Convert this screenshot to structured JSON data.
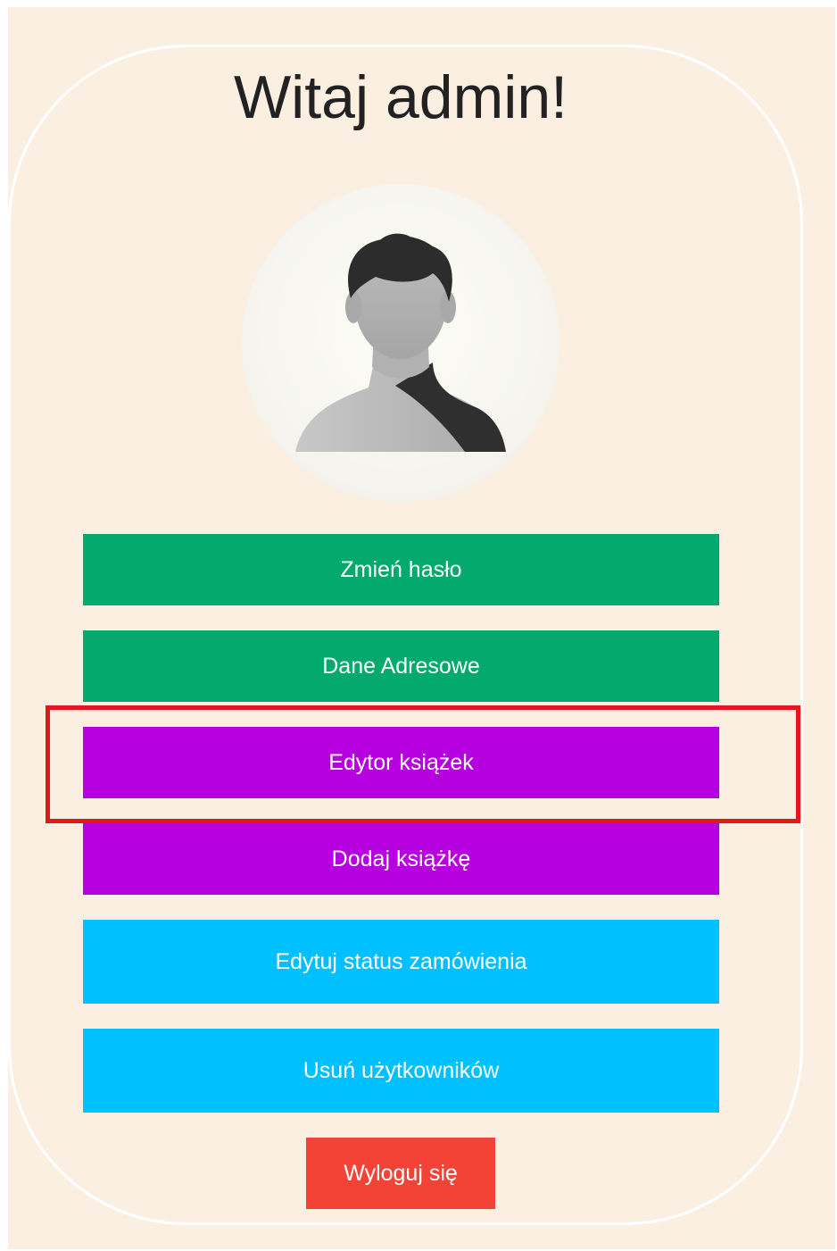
{
  "header": {
    "greeting": "Witaj admin!"
  },
  "avatar": {
    "icon": "user-silhouette-icon"
  },
  "menu": {
    "change_password": "Zmień hasło",
    "address_data": "Dane Adresowe",
    "book_editor": "Edytor książek",
    "add_book": "Dodaj książkę",
    "edit_order_status": "Edytuj status zamówienia",
    "delete_users": "Usuń użytkowników",
    "logout": "Wyloguj się"
  },
  "colors": {
    "page_background": "#fbefe2",
    "green": "#04aa6d",
    "purple": "#b700e0",
    "blue": "#00c0ff",
    "red": "#f44336",
    "highlight": "#e3161c"
  }
}
